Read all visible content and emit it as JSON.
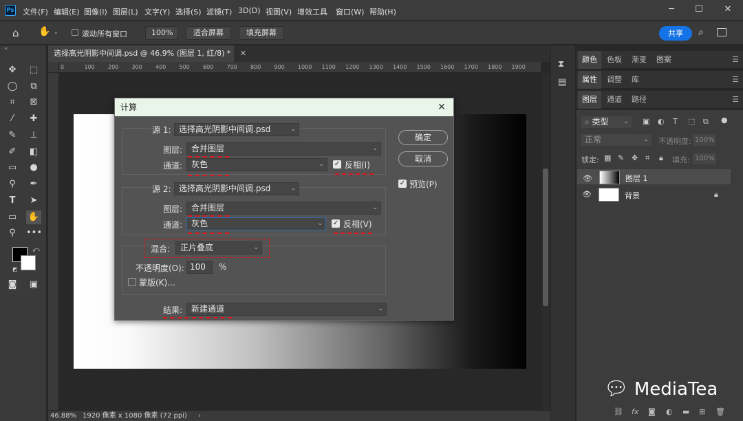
{
  "app": {
    "logo_text": "Ps"
  },
  "menu": [
    "文件(F)",
    "编辑(E)",
    "图像(I)",
    "图层(L)",
    "文字(Y)",
    "选择(S)",
    "滤镜(T)",
    "3D(D)",
    "视图(V)",
    "增效工具",
    "窗口(W)",
    "帮助(H)"
  ],
  "window_controls": {
    "minimize": "─",
    "maximize": "☐",
    "close": "✕"
  },
  "options": {
    "scroll_all": "滚动所有窗口",
    "zoom": "100%",
    "fit_screen": "适合屏幕",
    "fill_screen": "填充屏幕",
    "share": "共享"
  },
  "document": {
    "tab_title": "选择高光阴影中间调.psd @ 46.9% (图层 1, 红/8) *",
    "close_glyph": "✕"
  },
  "ruler": {
    "top": [
      "0",
      "100",
      "200",
      "300",
      "400",
      "500",
      "600",
      "700",
      "800",
      "900",
      "1000",
      "1100",
      "1200",
      "1300",
      "1400",
      "1500",
      "1600",
      "1700",
      "1800",
      "1900"
    ]
  },
  "status": {
    "zoom": "46.88%",
    "doc_info": "1920 像素 x 1080 像素 (72 ppi)"
  },
  "dialog": {
    "title": "计算",
    "close": "✕",
    "source1": {
      "label": "源 1:",
      "file": "选择高光阴影中间调.psd",
      "layer_label": "图层:",
      "layer": "合并图层",
      "channel_label": "通道:",
      "channel": "灰色",
      "invert_label": "反相(I)",
      "invert": true
    },
    "source2": {
      "label": "源 2:",
      "file": "选择高光阴影中间调.psd",
      "layer_label": "图层:",
      "layer": "合并图层",
      "channel_label": "通道:",
      "channel": "灰色",
      "invert_label": "反相(V)",
      "invert": true
    },
    "blend": {
      "label": "混合:",
      "mode": "正片叠底",
      "opacity_label": "不透明度(O):",
      "opacity": "100",
      "opacity_unit": "%",
      "mask_label": "蒙版(K)...",
      "mask": false
    },
    "result": {
      "label": "结果:",
      "value": "新建通道"
    },
    "ok": "确定",
    "cancel": "取消",
    "preview_label": "预览(P)",
    "preview": true
  },
  "panels": {
    "group1": [
      "颜色",
      "色板",
      "渐变",
      "图案"
    ],
    "group2": [
      "属性",
      "调整",
      "库"
    ],
    "group3": [
      "图层",
      "通道",
      "路径"
    ],
    "filter_kind": "类型",
    "blend_mode": "正常",
    "opacity_label": "不透明度:",
    "opacity": "100%",
    "lock_label": "锁定:",
    "fill_label": "填充:",
    "fill": "100%",
    "layers": [
      {
        "name": "图层 1",
        "selected": true
      },
      {
        "name": "背景",
        "selected": false,
        "locked": true
      }
    ]
  },
  "watermark": {
    "text": "MediaTea"
  },
  "colors": {
    "accent": "#1473e6",
    "annotation": "#e0141a",
    "dialog_title_bg": "#e8f5e8"
  }
}
